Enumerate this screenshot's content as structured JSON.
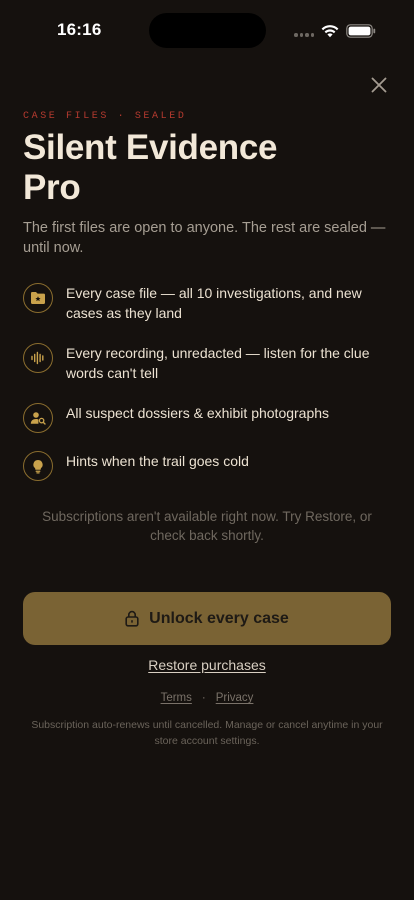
{
  "status_bar": {
    "time": "16:16",
    "icons": [
      "signal-dots-icon",
      "wifi-icon",
      "battery-icon"
    ]
  },
  "colors": {
    "background": "#15110e",
    "accent_gold": "#c9a24c",
    "eyebrow_red": "#b43a2f",
    "button_fill": "#7a6334"
  },
  "header": {
    "close_icon": "close-icon",
    "eyebrow": "CASE FILES · SEALED",
    "title_line1": "Silent Evidence",
    "title_line2": "Pro",
    "subtitle": "The first files are open to anyone. The rest are sealed — until now."
  },
  "features": [
    {
      "icon": "folder-star-icon",
      "text": "Every case file — all 10 investigations, and new cases as they land"
    },
    {
      "icon": "audio-waveform-icon",
      "text": "Every recording, unredacted — listen for the clue words can't tell"
    },
    {
      "icon": "user-search-icon",
      "text": "All suspect dossiers & exhibit photographs"
    },
    {
      "icon": "lightbulb-icon",
      "text": "Hints when the trail goes cold"
    }
  ],
  "notice": "Subscriptions aren't available right now. Try Restore, or check back shortly.",
  "cta": {
    "icon": "lock-icon",
    "label": "Unlock every case"
  },
  "restore_label": "Restore purchases",
  "legal": {
    "terms": "Terms",
    "separator": "·",
    "privacy": "Privacy"
  },
  "fine_print": "Subscription auto-renews until cancelled. Manage or cancel anytime in your store account settings."
}
